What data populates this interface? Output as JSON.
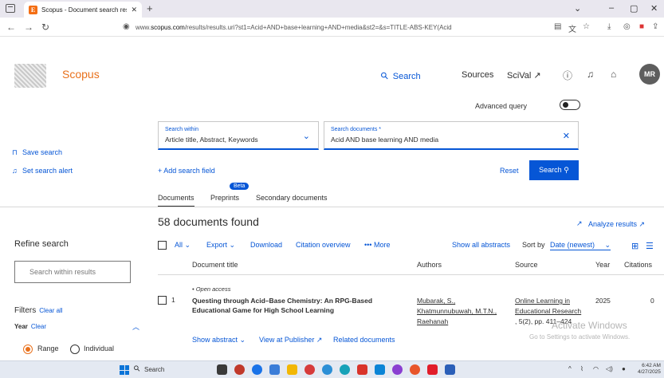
{
  "browser": {
    "tab_title": "Scopus - Document search resu",
    "tab_close": "✕",
    "new_tab": "+",
    "url_prefix": "www.",
    "url_domain": "scopus.com",
    "url_path": "/results/results.uri?st1=Acid+AND+base+learning+AND+media&st2=&s=TITLE-ABS-KEY(Acid"
  },
  "header": {
    "brand": "Scopus",
    "nav_search": "Search",
    "nav_sources": "Sources",
    "nav_scival": "SciVal ↗",
    "avatar": "MR"
  },
  "search": {
    "advanced_label": "Advanced query",
    "within_label": "Search within",
    "within_value": "Article title, Abstract, Keywords",
    "docs_label": "Search documents *",
    "docs_value": "Acid AND base learning AND media",
    "add_field": "+ Add search field",
    "reset": "Reset",
    "submit": "Search"
  },
  "sidebar": {
    "save_search": "Save search",
    "set_alert": "Set search alert",
    "refine_title": "Refine search",
    "search_within_placeholder": "Search within results",
    "filters_title": "Filters",
    "clear_all": "Clear all",
    "year_title": "Year",
    "year_clear": "Clear",
    "range_label": "Range",
    "individual_label": "Individual"
  },
  "subtabs": {
    "beta": "Beta",
    "documents": "Documents",
    "preprints": "Preprints",
    "secondary": "Secondary documents"
  },
  "results": {
    "count_title": "58 documents found",
    "analyze": "Analyze results ↗",
    "toolbar": {
      "all": "All",
      "export": "Export",
      "download": "Download",
      "citation_overview": "Citation overview",
      "more": "••• More",
      "show_abstracts": "Show all abstracts",
      "sort_by": "Sort by",
      "sort_value": "Date (newest)"
    },
    "columns": {
      "title": "Document title",
      "authors": "Authors",
      "source": "Source",
      "year": "Year",
      "citations": "Citations"
    },
    "rows": [
      {
        "index": "1",
        "access": "• Open access",
        "title": "Questing through Acid–Base Chemistry: An RPG-Based Educational Game for High School Learning",
        "author1": "Mubarak, S.,",
        "author2": "Khatmunnubuwah, M.T.N.,",
        "author3": "Raehanah",
        "source1": "Online Learning in",
        "source2": "Educational Research",
        "source3": ", 5(2), pp. 411–424",
        "year": "2025",
        "citations": "0",
        "show_abstract": "Show abstract",
        "view_publisher": "View at Publisher ↗",
        "related": "Related documents"
      }
    ]
  },
  "watermark": {
    "line1": "Activate Windows",
    "line2": "Go to Settings to activate Windows."
  },
  "taskbar": {
    "search": "Search",
    "time": "6:42 AM",
    "date": "4/27/2025"
  },
  "colors": {
    "accent_blue": "#0656d6",
    "brand_orange": "#e9711c"
  }
}
